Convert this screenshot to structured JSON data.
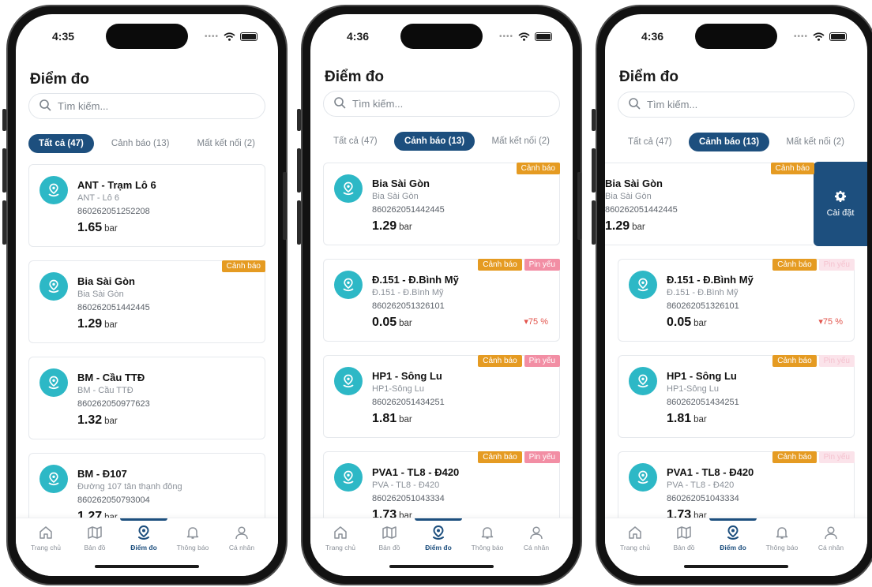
{
  "phones": [
    {
      "time": "4:35",
      "title": "Điểm đo",
      "search_placeholder": "Tìm kiếm...",
      "tabs": [
        {
          "label": "Tất cả (47)",
          "active": true
        },
        {
          "label": "Cảnh báo (13)",
          "active": false
        },
        {
          "label": "Mất kết nối (2)",
          "active": false
        }
      ],
      "cards": [
        {
          "name": "ANT - Trạm Lô 6",
          "sub": "ANT - Lô 6",
          "imei": "860262051252208",
          "value": "1.65",
          "unit": "bar",
          "badges": []
        },
        {
          "name": "Bia Sài Gòn",
          "sub": "Bia Sài Gòn",
          "imei": "860262051442445",
          "value": "1.29",
          "unit": "bar",
          "badges": [
            {
              "label": "Cảnh báo",
              "kind": "warn"
            }
          ]
        },
        {
          "name": "BM - Cầu TTĐ",
          "sub": "BM - Cầu TTĐ",
          "imei": "860262050977623",
          "value": "1.32",
          "unit": "bar",
          "badges": []
        },
        {
          "name": "BM - Đ107",
          "sub": "Đường 107 tân thạnh đông",
          "imei": "860262050793004",
          "value": "1.27",
          "unit": "bar",
          "badges": []
        }
      ],
      "nav": [
        {
          "label": "Trang chủ",
          "icon": "home-icon",
          "active": false
        },
        {
          "label": "Bản đồ",
          "icon": "map-icon",
          "active": false
        },
        {
          "label": "Điểm đo",
          "icon": "location-pin-icon",
          "active": true
        },
        {
          "label": "Thông báo",
          "icon": "bell-icon",
          "active": false
        },
        {
          "label": "Cá nhân",
          "icon": "user-icon",
          "active": false
        }
      ]
    },
    {
      "time": "4:36",
      "title": "Điểm đo",
      "search_placeholder": "Tìm kiếm...",
      "tabs": [
        {
          "label": "Tất cả (47)",
          "active": false
        },
        {
          "label": "Cảnh báo (13)",
          "active": true
        },
        {
          "label": "Mất kết nối (2)",
          "active": false
        }
      ],
      "cards": [
        {
          "name": "Bia Sài Gòn",
          "sub": "Bia Sài Gòn",
          "imei": "860262051442445",
          "value": "1.29",
          "unit": "bar",
          "badges": [
            {
              "label": "Cảnh báo",
              "kind": "warn"
            }
          ]
        },
        {
          "name": "Đ.151 - Đ.Bình Mỹ",
          "sub": "Đ.151 - Đ.Bình Mỹ",
          "imei": "860262051326101",
          "value": "0.05",
          "unit": "bar",
          "trend": "75 %",
          "badges": [
            {
              "label": "Cảnh báo",
              "kind": "warn"
            },
            {
              "label": "Pin yếu",
              "kind": "pin-low"
            }
          ]
        },
        {
          "name": "HP1 - Sông Lu",
          "sub": "HP1-Sông Lu",
          "imei": "860262051434251",
          "value": "1.81",
          "unit": "bar",
          "badges": [
            {
              "label": "Cảnh báo",
              "kind": "warn"
            },
            {
              "label": "Pin yếu",
              "kind": "pin-low"
            }
          ]
        },
        {
          "name": "PVA1 - TL8 - Đ420",
          "sub": "PVA - TL8 - Đ420",
          "imei": "860262051043334",
          "value": "1.73",
          "unit": "bar",
          "badges": [
            {
              "label": "Cảnh báo",
              "kind": "warn"
            },
            {
              "label": "Pin yếu",
              "kind": "pin-low"
            }
          ]
        }
      ],
      "nav": [
        {
          "label": "Trang chủ",
          "icon": "home-icon",
          "active": false
        },
        {
          "label": "Bản đồ",
          "icon": "map-icon",
          "active": false
        },
        {
          "label": "Điểm đo",
          "icon": "location-pin-icon",
          "active": true
        },
        {
          "label": "Thông báo",
          "icon": "bell-icon",
          "active": false
        },
        {
          "label": "Cá nhân",
          "icon": "user-icon",
          "active": false
        }
      ]
    },
    {
      "time": "4:36",
      "title": "Điểm đo",
      "search_placeholder": "Tìm kiếm...",
      "tabs": [
        {
          "label": "Tất cả (47)",
          "active": false
        },
        {
          "label": "Cảnh báo (13)",
          "active": true
        },
        {
          "label": "Mất kết nối (2)",
          "active": false
        }
      ],
      "swipe_action_label": "Cài đặt",
      "cards": [
        {
          "name": "Bia Sài Gòn",
          "sub": "Bia Sài Gòn",
          "imei": "860262051442445",
          "value": "1.29",
          "unit": "bar",
          "swiped": true,
          "badges": [
            {
              "label": "Cảnh báo",
              "kind": "warn"
            }
          ]
        },
        {
          "name": "Đ.151 - Đ.Bình Mỹ",
          "sub": "Đ.151 - Đ.Bình Mỹ",
          "imei": "860262051326101",
          "value": "0.05",
          "unit": "bar",
          "trend": "75 %",
          "badges": [
            {
              "label": "Cảnh báo",
              "kind": "warn"
            },
            {
              "label": "Pin yếu",
              "kind": "pin-faded"
            }
          ]
        },
        {
          "name": "HP1 - Sông Lu",
          "sub": "HP1-Sông Lu",
          "imei": "860262051434251",
          "value": "1.81",
          "unit": "bar",
          "badges": [
            {
              "label": "Cảnh báo",
              "kind": "warn"
            },
            {
              "label": "Pin yếu",
              "kind": "pin-faded"
            }
          ]
        },
        {
          "name": "PVA1 - TL8 - Đ420",
          "sub": "PVA - TL8 - Đ420",
          "imei": "860262051043334",
          "value": "1.73",
          "unit": "bar",
          "badges": [
            {
              "label": "Cảnh báo",
              "kind": "warn"
            },
            {
              "label": "Pin yếu",
              "kind": "pin-faded"
            }
          ]
        }
      ],
      "nav": [
        {
          "label": "Trang chủ",
          "icon": "home-icon",
          "active": false
        },
        {
          "label": "Bản đồ",
          "icon": "map-icon",
          "active": false
        },
        {
          "label": "Điểm đo",
          "icon": "location-pin-icon",
          "active": true
        },
        {
          "label": "Thông báo",
          "icon": "bell-icon",
          "active": false
        },
        {
          "label": "Cá nhân",
          "icon": "user-icon",
          "active": false
        }
      ]
    }
  ]
}
